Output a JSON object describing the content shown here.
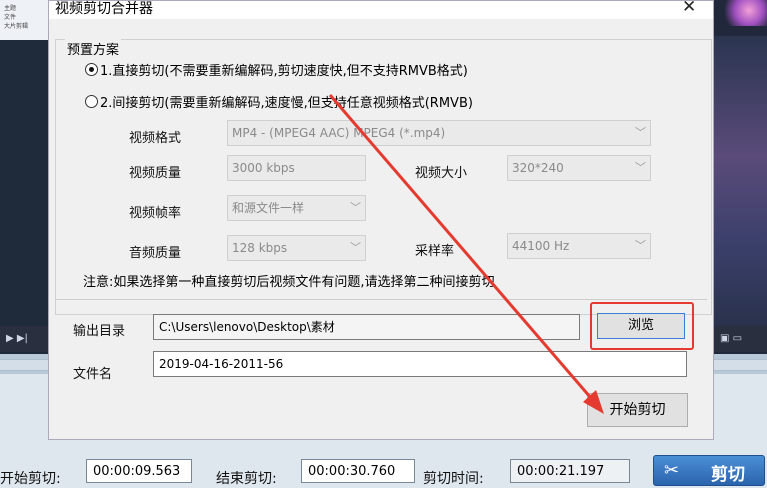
{
  "background": {
    "left_list": [
      "主题",
      "文件",
      "大片剪辑"
    ],
    "left_controls": "▶ ▶|",
    "right_controls": "▣ ▭"
  },
  "dialog": {
    "title": "视频剪切合并器",
    "close_glyph": "✕",
    "preset_group_label": "预置方案",
    "option1_label": "1.直接剪切(不需要重新编解码,剪切速度快,但不支持RMVB格式)",
    "option1_selected": true,
    "option2_label": "2.间接剪切(需要重新编解码,速度慢,但支持任意视频格式(RMVB)",
    "option2_selected": false,
    "video_format_label": "视频格式",
    "video_format_value": "MP4 - (MPEG4 AAC) MPEG4 (*.mp4)",
    "video_quality_label": "视频质量",
    "video_quality_value": "3000 kbps",
    "video_size_label": "视频大小",
    "video_size_value": "320*240",
    "frame_rate_label": "视频帧率",
    "frame_rate_value": "和源文件一样",
    "audio_quality_label": "音频质量",
    "audio_quality_value": "128 kbps",
    "sample_rate_label": "采样率",
    "sample_rate_value": "44100 Hz",
    "note": "注意:如果选择第一种直接剪切后视频文件有问题,请选择第二种间接剪切",
    "output_dir_label": "输出目录",
    "output_dir_value": "C:\\Users\\lenovo\\Desktop\\素材",
    "browse_label": "浏览",
    "filename_label": "文件名",
    "filename_value": "2019-04-16-2011-56",
    "start_label": "开始剪切"
  },
  "bottom_bar": {
    "start_cut_label": "开始剪切:",
    "start_cut_value": "00:00:09.563",
    "end_cut_label": "结束剪切:",
    "end_cut_value": "00:00:30.760",
    "duration_label": "剪切时间:",
    "duration_value": "00:00:21.197",
    "cut_button_label": "剪切",
    "cut_button_icon": "scissors-icon"
  },
  "colors": {
    "annotation_red": "#e53a2f",
    "cut_button_blue": "#2b64ad",
    "focus_blue": "#3b7dd6"
  }
}
